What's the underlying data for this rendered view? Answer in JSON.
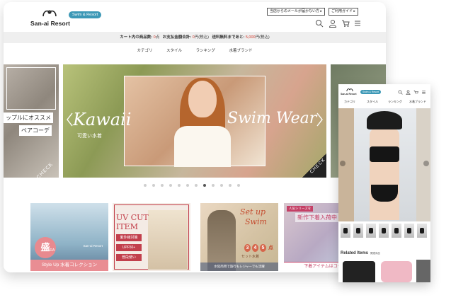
{
  "desktop": {
    "header": {
      "logo_text": "San-ai Resort",
      "badge": "Swim & Resort",
      "mail_button": "当店からのメールが届かない方",
      "guide_button": "ご利用ガイド"
    },
    "icons": [
      "search-icon",
      "user-icon",
      "cart-icon",
      "menu-icon"
    ],
    "cart_bar": {
      "label_items": "カート内の商品数:",
      "items_value": "0",
      "items_unit": "点",
      "label_total": "お支払金額合計:",
      "total_value": "0",
      "total_unit": "円(税込)",
      "label_free": "送料無料まであと:",
      "free_value": "5,000",
      "free_unit": "円(税込)"
    },
    "nav": [
      "カテゴリ",
      "スタイル",
      "ランキング",
      "水着ブランド"
    ],
    "hero_left": {
      "line1": "ップルにオススメ",
      "line2": "ペアコーデ",
      "check": "CHECK"
    },
    "hero": {
      "left_word": "Kawaii",
      "subtitle": "可愛い水着",
      "right_word": "Swim Wear",
      "check": "CHECK"
    },
    "carousel": {
      "count": 12,
      "active_index": 7
    },
    "tiles": [
      {
        "sticker": "盛",
        "sticker_small": "BRA",
        "brand": "San-ai Resort",
        "footer": "Style Up 水着コレクション"
      },
      {
        "title_line1": "UV CUT",
        "title_line2": "ITEM",
        "pills": [
          "紫外線対策",
          "UPF50+",
          "普段使い"
        ]
      },
      {
        "title_line1": "Set up",
        "title_line2": "Swim",
        "numbers": [
          "3",
          "4",
          "5"
        ],
        "number_suffix": "点",
        "set_label": "セット水着",
        "footer": "水陸両用で旅行もレジャーでも活躍"
      },
      {
        "tag": "人気シリーズを",
        "heading": "新作下着入荷中",
        "footer": "下着アイテムはコチ"
      }
    ]
  },
  "mobile": {
    "logo_text": "San-ai Resort",
    "badge": "Swim & Resort",
    "nav": [
      "カテゴリ",
      "スタイル",
      "ランキング",
      "水着ブランド"
    ],
    "related_title": "Related Items",
    "related_sub": "関連商品",
    "thumb_count": 7
  },
  "colors": {
    "accent_blue": "#3c98b6",
    "price_red": "#d0392b",
    "pink": "#e98d93",
    "uv_red": "#c03a46"
  }
}
